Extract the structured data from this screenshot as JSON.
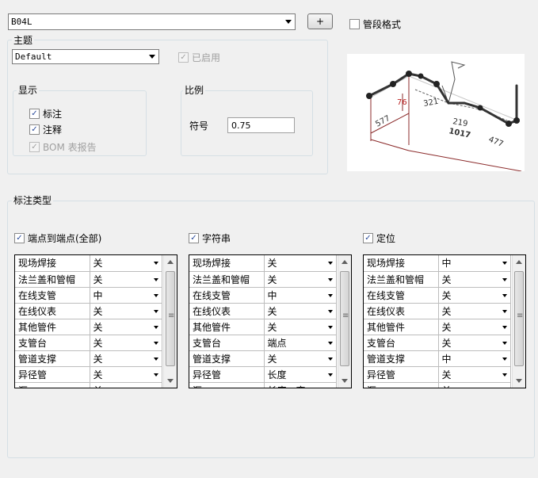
{
  "top": {
    "style_combo_value": "B04L",
    "add_button_label": "+",
    "pipe_segment_format_label": "管段格式",
    "pipe_segment_format_checked": false
  },
  "theme": {
    "group_label": "主题",
    "combo_value": "Default",
    "enabled_label": "已启用",
    "enabled_checked": true
  },
  "display": {
    "group_label": "显示",
    "items": [
      {
        "label": "标注",
        "checked": true,
        "disabled": false
      },
      {
        "label": "注释",
        "checked": true,
        "disabled": false
      },
      {
        "label": "BOM 表报告",
        "checked": true,
        "disabled": true
      }
    ]
  },
  "scale": {
    "group_label": "比例",
    "symbol_label": "符号",
    "symbol_value": "0.75"
  },
  "preview": {
    "dims": [
      "76",
      "577",
      "321",
      "219",
      "1017",
      "477"
    ]
  },
  "dimension_types": {
    "group_label": "标注类型",
    "columns": [
      {
        "label": "端点到端点(全部)",
        "checked": true,
        "rows": [
          [
            "现场焊接",
            "关"
          ],
          [
            "法兰盖和管帽",
            "关"
          ],
          [
            "在线支管",
            "中"
          ],
          [
            "在线仪表",
            "关"
          ],
          [
            "其他管件",
            "关"
          ],
          [
            "支管台",
            "关"
          ],
          [
            "管道支撑",
            "关"
          ],
          [
            "异径管",
            "关"
          ],
          [
            "汇",
            "关"
          ]
        ]
      },
      {
        "label": "字符串",
        "checked": true,
        "rows": [
          [
            "现场焊接",
            "关"
          ],
          [
            "法兰盖和管帽",
            "关"
          ],
          [
            "在线支管",
            "中"
          ],
          [
            "在线仪表",
            "关"
          ],
          [
            "其他管件",
            "关"
          ],
          [
            "支管台",
            "端点"
          ],
          [
            "管道支撑",
            "关"
          ],
          [
            "异径管",
            "长度"
          ],
          [
            "汇",
            "长度 - 弯"
          ]
        ]
      },
      {
        "label": "定位",
        "checked": true,
        "rows": [
          [
            "现场焊接",
            "中"
          ],
          [
            "法兰盖和管帽",
            "关"
          ],
          [
            "在线支管",
            "关"
          ],
          [
            "在线仪表",
            "关"
          ],
          [
            "其他管件",
            "关"
          ],
          [
            "支管台",
            "关"
          ],
          [
            "管道支撑",
            "中"
          ],
          [
            "异径管",
            "关"
          ],
          [
            "汇",
            "关"
          ]
        ]
      }
    ]
  }
}
